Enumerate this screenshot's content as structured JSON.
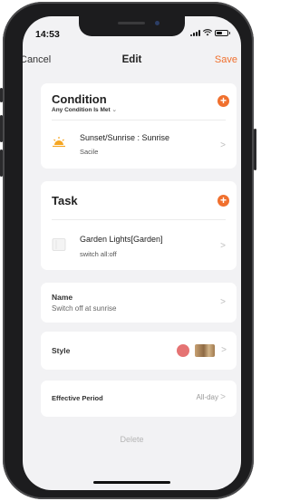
{
  "status_bar": {
    "time": "14:53"
  },
  "nav": {
    "cancel": "Cancel",
    "title": "Edit",
    "save": "Save"
  },
  "condition": {
    "title": "Condition",
    "mode": "Any Condition Is Met",
    "mode_arrow": "⌄",
    "add": "+",
    "item": {
      "icon": "sunrise-icon",
      "title": "Sunset/Sunrise : Sunrise",
      "subtitle": "Sacile"
    }
  },
  "task": {
    "title": "Task",
    "add": "+",
    "item": {
      "icon": "device-icon",
      "title": "Garden Lights[Garden]",
      "subtitle": "switch all:off"
    }
  },
  "name": {
    "label": "Name",
    "value": "Switch off at sunrise"
  },
  "style": {
    "label": "Style",
    "color": "#e57373"
  },
  "effective_period": {
    "label": "Effective Period",
    "value": "All-day"
  },
  "chevron": ">",
  "delete": "Delete",
  "colors": {
    "accent": "#f0702e",
    "background": "#f2f2f4"
  }
}
